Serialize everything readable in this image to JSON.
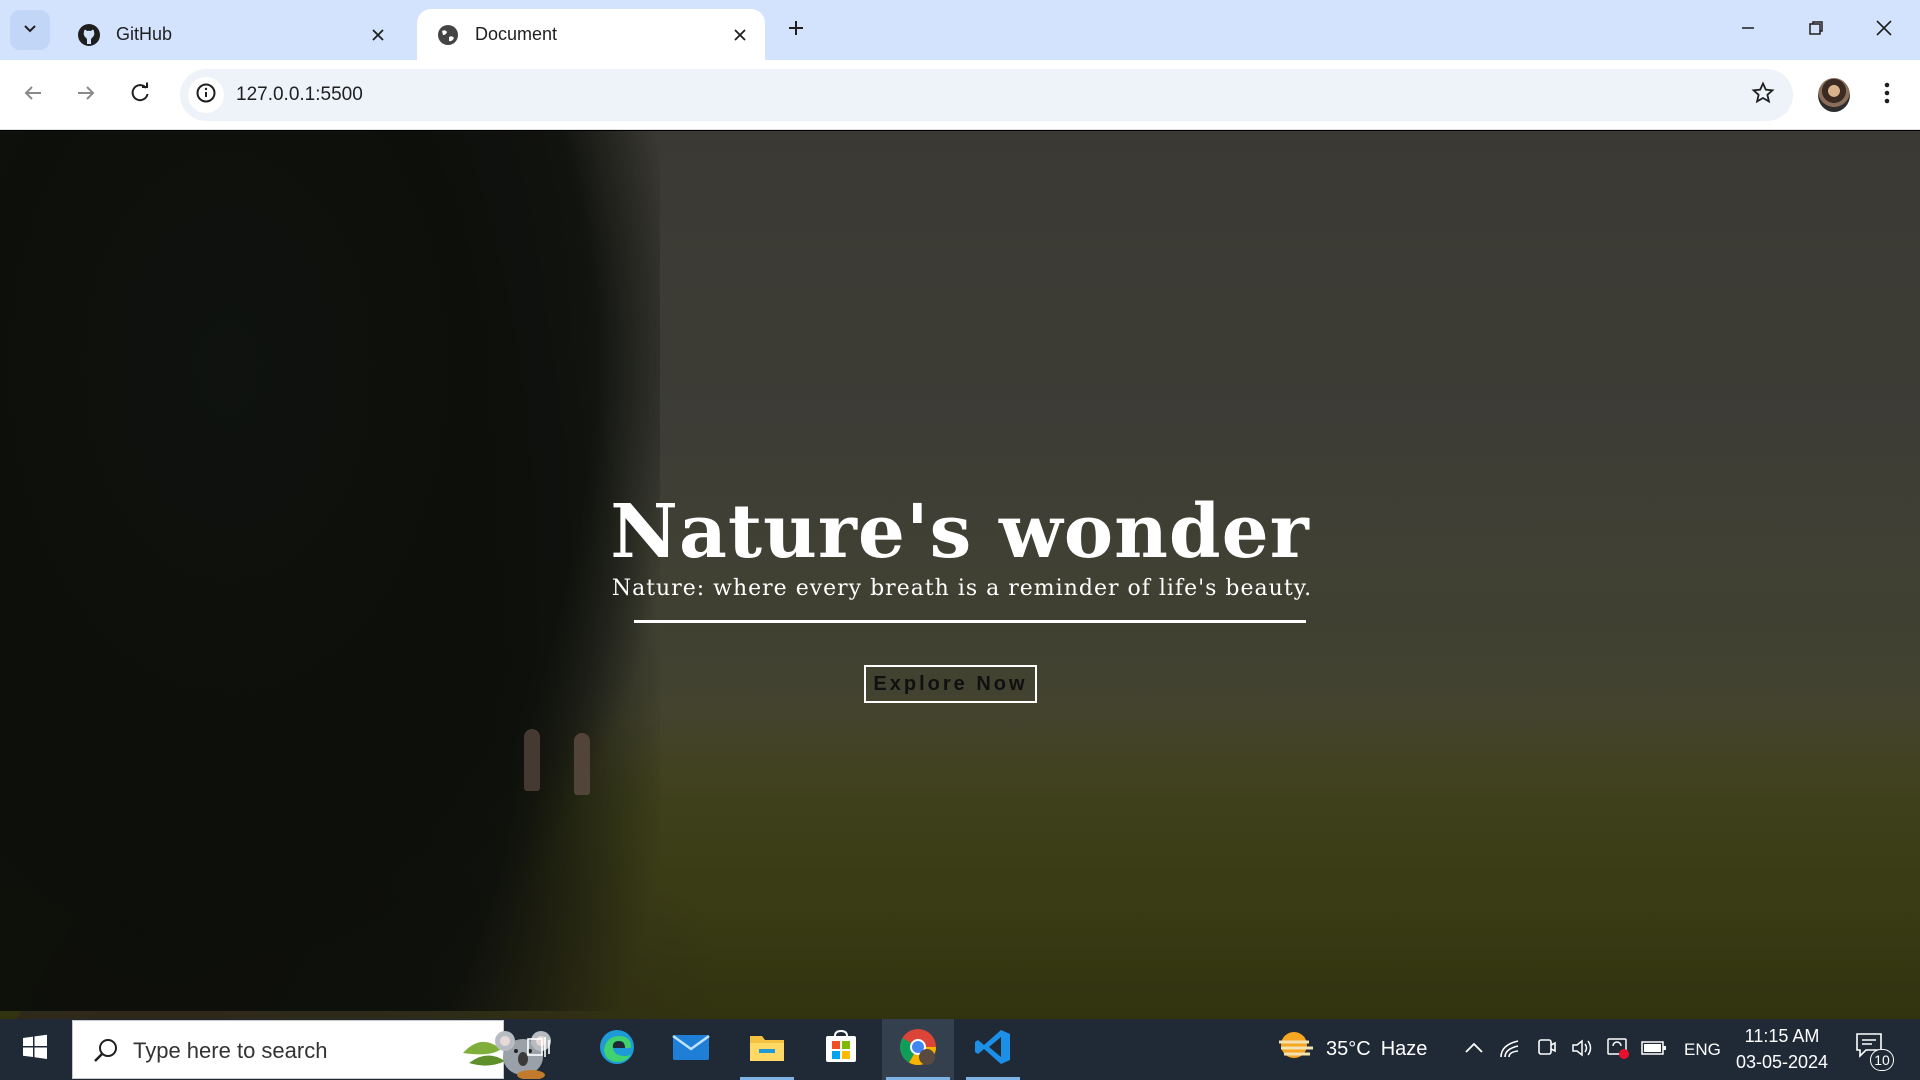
{
  "browser": {
    "tabs": [
      {
        "title": "GitHub",
        "icon": "github-icon",
        "active": false
      },
      {
        "title": "Document",
        "icon": "globe-icon",
        "active": true
      }
    ],
    "url": "127.0.0.1:5500"
  },
  "page": {
    "hero_title": "Nature's wonder",
    "hero_subtitle": "Nature: where every breath is a reminder of life's beauty.",
    "cta_label": "Explore Now"
  },
  "taskbar": {
    "search_placeholder": "Type here to search",
    "apps": [
      "task-view-icon",
      "edge-icon",
      "mail-icon",
      "file-explorer-icon",
      "store-icon",
      "chrome-icon",
      "vscode-icon"
    ],
    "weather": {
      "temp": "35°C",
      "condition": "Haze"
    },
    "language": "ENG",
    "time": "11:15 AM",
    "date": "03-05-2024",
    "notification_count": "10"
  },
  "colors": {
    "tabstrip": "#d3e3fd",
    "toolbar": "#ffffff",
    "omnibox": "#eef2f9",
    "taskbar": "#1f2a36",
    "hero_text": "#ffffff"
  }
}
